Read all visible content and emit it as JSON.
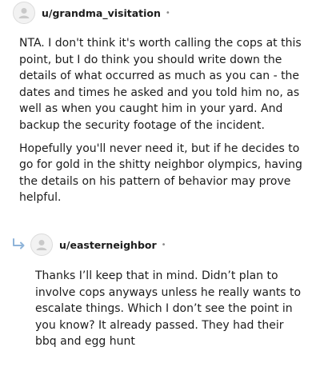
{
  "comment1": {
    "username": "u/grandma_visitation",
    "separator": "•",
    "paragraphs": [
      "NTA. I don't think it's worth calling the cops at this point, but I do think you should write down the details of what occurred as much as you can - the dates and times he asked and you told him no, as well as when you caught him in your yard. And backup the security footage of the incident.",
      "Hopefully you'll never need it, but if he decides to go for gold in the shitty neighbor olympics, having the details on his pattern of behavior may prove helpful."
    ]
  },
  "comment2": {
    "username": "u/easterneighbor",
    "separator": "•",
    "paragraphs": [
      "Thanks I’ll keep that in mind. Didn’t plan to involve cops anyways unless he really wants to escalate things. Which I don’t see the point in you know? It already passed. They had their bbq and egg hunt"
    ]
  },
  "icons": {
    "avatar": "user-avatar-icon",
    "reply": "reply-arrow-icon"
  },
  "colors": {
    "text": "#1c1c1c",
    "muted": "#8a8a8a",
    "avatar_bg": "#f2f2f2",
    "reply_arrow": "#8fb4d9"
  }
}
